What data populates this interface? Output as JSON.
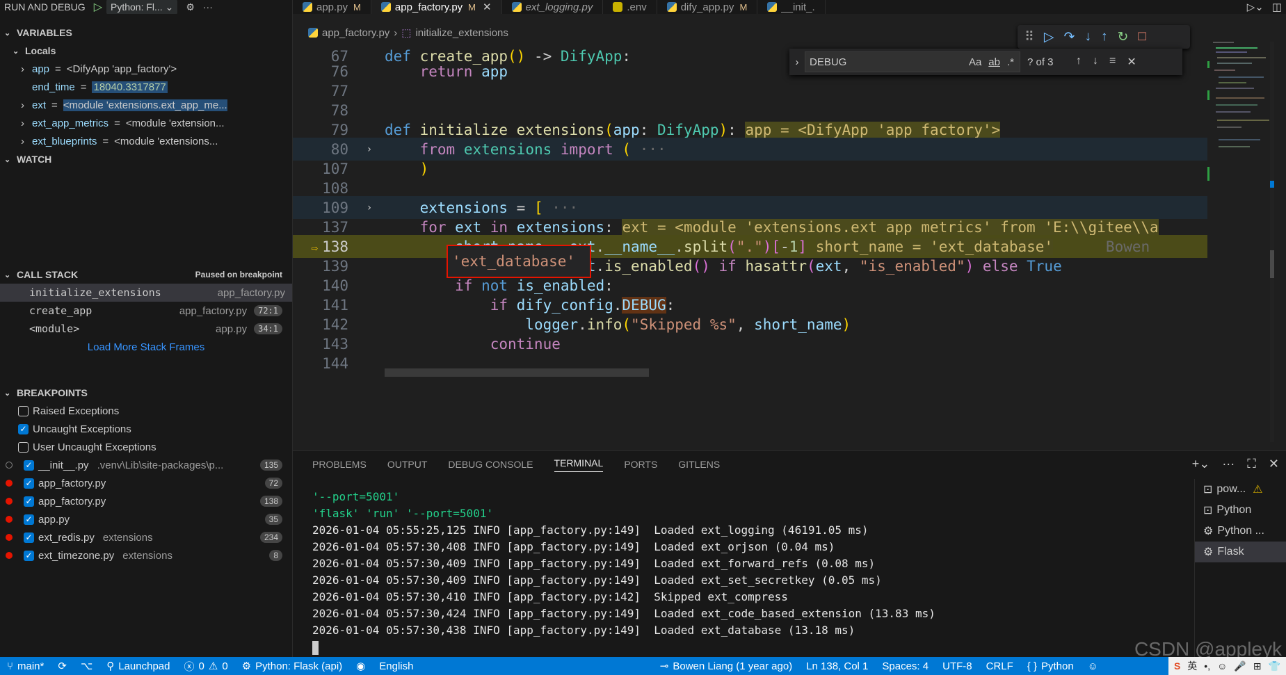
{
  "sidebar": {
    "title": "RUN AND DEBUG",
    "config": "Python: Fl...",
    "variables_header": "VARIABLES",
    "locals_header": "Locals",
    "vars": [
      {
        "name": "app",
        "value": "<DifyApp 'app_factory'>",
        "expand": "›"
      },
      {
        "name": "end_time",
        "value": "18040.3317877",
        "expand": ""
      },
      {
        "name": "ext",
        "value": "<module 'extensions.ext_app_me...",
        "expand": "›"
      },
      {
        "name": "ext_app_metrics",
        "value": "<module 'extension...",
        "expand": "›"
      },
      {
        "name": "ext_blueprints",
        "value": "<module 'extensions...",
        "expand": "›"
      }
    ],
    "watch_header": "WATCH",
    "callstack_header": "CALL STACK",
    "callstack_status": "Paused on breakpoint",
    "frames": [
      {
        "fn": "initialize_extensions",
        "file": "app_factory.py",
        "line": ""
      },
      {
        "fn": "create_app",
        "file": "app_factory.py",
        "line": "72:1"
      },
      {
        "fn": "<module>",
        "file": "app.py",
        "line": "34:1"
      }
    ],
    "load_more": "Load More Stack Frames",
    "breakpoints_header": "BREAKPOINTS",
    "breakpoints": [
      {
        "label": "Raised Exceptions",
        "path": "",
        "line": ""
      },
      {
        "label": "Uncaught Exceptions",
        "path": "",
        "line": ""
      },
      {
        "label": "User Uncaught Exceptions",
        "path": "",
        "line": ""
      },
      {
        "label": "__init__.py",
        ".venv": "",
        "path": ".venv\\Lib\\site-packages\\p...",
        "line": "135"
      },
      {
        "label": "app_factory.py",
        "path": "",
        "line": "72"
      },
      {
        "label": "app_factory.py",
        "path": "",
        "line": "138"
      },
      {
        "label": "app.py",
        "path": "",
        "line": "35"
      },
      {
        "label": "ext_redis.py",
        "path": "extensions",
        "line": "234"
      },
      {
        "label": "ext_timezone.py",
        "path": "extensions",
        "line": "8"
      }
    ]
  },
  "tabs": [
    {
      "label": "app.py",
      "mod": "M"
    },
    {
      "label": "app_factory.py",
      "mod": "M"
    },
    {
      "label": "ext_logging.py",
      "mod": ""
    },
    {
      "label": ".env",
      "mod": ""
    },
    {
      "label": "dify_app.py",
      "mod": "M"
    },
    {
      "label": "__init_.",
      "mod": ""
    }
  ],
  "breadcrumb": {
    "file": "app_factory.py",
    "symbol": "initialize_extensions"
  },
  "find": {
    "query": "DEBUG",
    "count": "? of 3",
    "case": "Aa",
    "word": "ab",
    "regex": ".*"
  },
  "code": {
    "lines": [
      "67",
      "76",
      "77",
      "78",
      "79",
      "80",
      "107",
      "108",
      "109",
      "137",
      "138",
      "139",
      "140",
      "141",
      "142",
      "143",
      "144"
    ],
    "hover_value": "'ext_database'",
    "blame": "Bowen"
  },
  "panel": {
    "tabs": [
      "PROBLEMS",
      "OUTPUT",
      "DEBUG CONSOLE",
      "TERMINAL",
      "PORTS",
      "GITLENS"
    ],
    "terminal": [
      "'--port=5001'",
      "'flask' 'run' '--port=5001'",
      "2026-01-04 05:55:25,125 INFO [app_factory.py:149]  Loaded ext_logging (46191.05 ms)",
      "2026-01-04 05:57:30,408 INFO [app_factory.py:149]  Loaded ext_orjson (0.04 ms)",
      "2026-01-04 05:57:30,409 INFO [app_factory.py:149]  Loaded ext_forward_refs (0.08 ms)",
      "2026-01-04 05:57:30,409 INFO [app_factory.py:149]  Loaded ext_set_secretkey (0.05 ms)",
      "2026-01-04 05:57:30,410 INFO [app_factory.py:142]  Skipped ext_compress",
      "2026-01-04 05:57:30,424 INFO [app_factory.py:149]  Loaded ext_code_based_extension (13.83 ms)",
      "2026-01-04 05:57:30,438 INFO [app_factory.py:149]  Loaded ext_database (13.18 ms)"
    ],
    "terminals": [
      "pow...",
      "Python",
      "Python ...",
      "Flask"
    ]
  },
  "status": {
    "branch": "main*",
    "launchpad": "Launchpad",
    "problems": "0",
    "warnings": "0",
    "debug": "Python: Flask (api)",
    "lang": "English",
    "blame": "Bowen Liang (1 year ago)",
    "pos": "Ln 138, Col 1",
    "spaces": "Spaces: 4",
    "enc": "UTF-8",
    "eol": "CRLF",
    "mode": "Python"
  },
  "ime": {
    "lang": "英"
  },
  "watermark": "CSDN @appleyk"
}
